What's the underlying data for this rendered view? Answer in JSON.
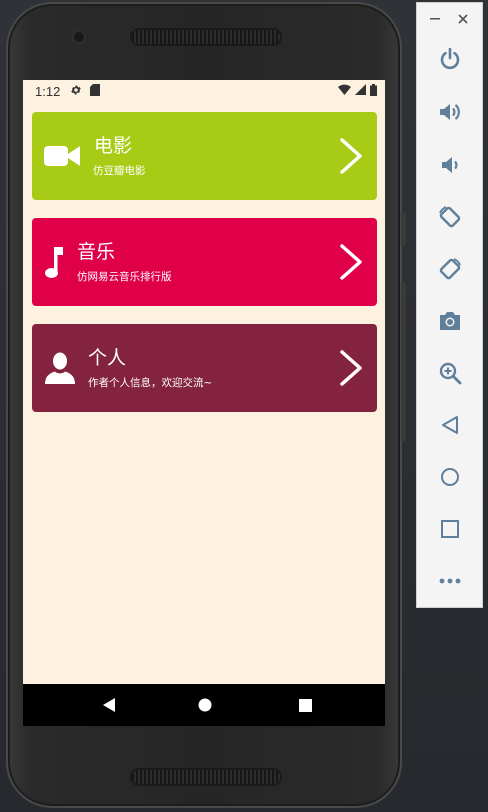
{
  "statusbar": {
    "time": "1:12"
  },
  "cards": [
    {
      "title": "电影",
      "subtitle": "仿豆瓣电影",
      "color": "#a8cc16",
      "icon": "video-camera-icon"
    },
    {
      "title": "音乐",
      "subtitle": "仿网易云音乐排行版",
      "color": "#e0004a",
      "icon": "music-note-icon"
    },
    {
      "title": "个人",
      "subtitle": "作者个人信息，欢迎交流~",
      "color": "#84233f",
      "icon": "person-icon"
    }
  ],
  "navbar": {
    "icons": [
      "back-triangle-icon",
      "home-circle-icon",
      "recents-square-icon"
    ]
  },
  "emulator_toolbar": {
    "window_controls": [
      "minimize-icon",
      "close-icon"
    ],
    "buttons": [
      "power-icon",
      "volume-up-icon",
      "volume-down-icon",
      "rotate-left-icon",
      "rotate-right-icon",
      "camera-icon",
      "zoom-icon",
      "back-icon",
      "home-icon",
      "overview-icon",
      "more-icon"
    ],
    "icon_color": "#5f7f9a"
  },
  "colors": {
    "screen_background": "#fdf2e0",
    "navbar_background": "#000000"
  }
}
